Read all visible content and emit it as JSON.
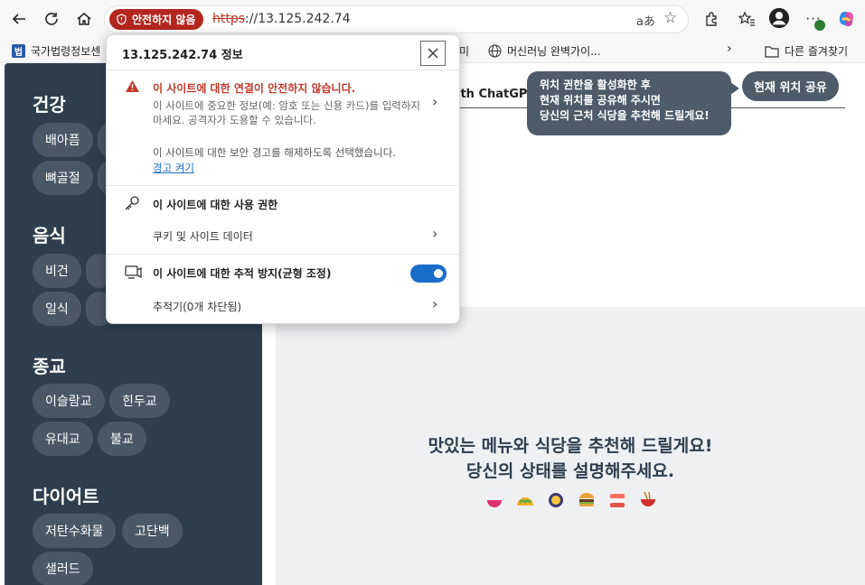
{
  "browser": {
    "security_badge": "안전하지 않음",
    "url_scheme": "https",
    "url_rest": "://13.125.242.74",
    "translate_glyph": "aあ"
  },
  "bookmarks": {
    "item1": "국가법령정보센",
    "item1_icon": "법",
    "item2_partial": "미",
    "item3": "머신러닝 완벽가이...",
    "other": "다른 즐겨찾기"
  },
  "popup": {
    "title": "13.125.242.74 정보",
    "warning_head": "이 사이트에 대한 연결이 안전하지 않습니다.",
    "warning_body": "이 사이트에 중요한 정보(예: 암호 또는 신용 카드)를 입력하지 마세요. 공격자가 도용할 수 있습니다.",
    "note": "이 사이트에 대한 보안 경고를 해제하도록 선택했습니다.",
    "link": "경고 켜기",
    "permissions": "이 사이트에 대한 사용 권한",
    "cookies": "쿠키 및 사이트 데이터",
    "tracking": "이 사이트에 대한 추적 방지(균형 조정)",
    "trackers": "추적기(0개 차단됨)"
  },
  "sidebar": {
    "health": {
      "title": "건강",
      "items": [
        "배아픔",
        "뼈골절"
      ]
    },
    "food": {
      "title": "음식",
      "items": [
        "비건",
        "일식"
      ]
    },
    "religion": {
      "title": "종교",
      "items": [
        "이슬람교",
        "힌두교",
        "유대교",
        "불교"
      ]
    },
    "diet": {
      "title": "다이어트",
      "items": [
        "저탄수화물",
        "고단백",
        "샐러드"
      ]
    }
  },
  "main": {
    "brand_partial": "ith ChatGPT",
    "tooltip_line1": "위치 권한을 활성화한 후",
    "tooltip_line2": "현재 위치를 공유해 주시면",
    "tooltip_line3": "당신의 근처 식당을 추천해 드릴게요!",
    "share_location": "현재 위치 공유",
    "welcome_line1": "맛있는 메뉴와 식당을 추천해 드릴게요!",
    "welcome_line2": "당신의 상태를 설명해주세요."
  },
  "colors": {
    "sidebar_bg": "#2f3e4f",
    "pill_bg": "#4a5766",
    "danger": "#b3261e",
    "accent": "#1a6cc9"
  }
}
